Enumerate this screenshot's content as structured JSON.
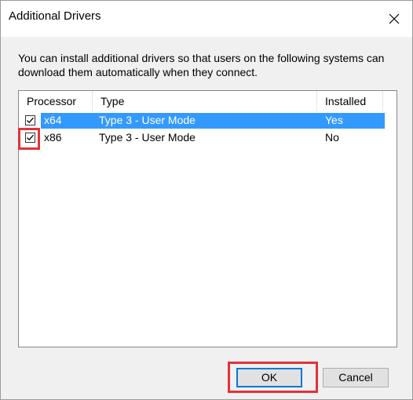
{
  "window": {
    "title": "Additional Drivers"
  },
  "description": "You can install additional drivers so that users on the following systems can download them automatically when they connect.",
  "columns": {
    "processor": "Processor",
    "type": "Type",
    "installed": "Installed"
  },
  "drivers": [
    {
      "processor": "x64",
      "type": "Type 3 - User Mode",
      "installed": "Yes",
      "checked": true,
      "selected": true
    },
    {
      "processor": "x86",
      "type": "Type 3 - User Mode",
      "installed": "No",
      "checked": true,
      "selected": false
    }
  ],
  "buttons": {
    "ok": "OK",
    "cancel": "Cancel"
  },
  "icons": {
    "close": "close-icon",
    "check": "checkmark-icon"
  },
  "colors": {
    "selection": "#3399ff",
    "highlight_box": "#e2323a",
    "default_button_border": "#0078d7"
  }
}
